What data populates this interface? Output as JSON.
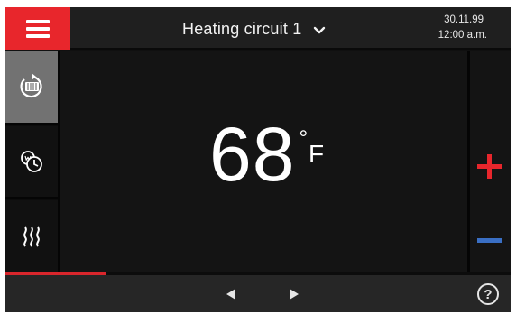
{
  "header": {
    "menu_icon": "hamburger-menu-icon",
    "title": "Heating circuit 1",
    "dropdown_icon": "chevron-down-icon",
    "date": "30.11.99",
    "time": "12:00 a.m."
  },
  "sidebar": {
    "items": [
      {
        "name": "manual-mode",
        "icon": "radiator-cycle-icon",
        "active": true
      },
      {
        "name": "timer-program",
        "icon": "clock-program-icon",
        "active": false
      },
      {
        "name": "heating",
        "icon": "heat-waves-icon",
        "active": false
      }
    ]
  },
  "main": {
    "temperature": "68",
    "degree_symbol": "°",
    "unit": "F"
  },
  "controls": {
    "increase_icon": "plus-icon",
    "decrease_icon": "minus-icon"
  },
  "progress": {
    "fraction": 0.2
  },
  "footer": {
    "prev_icon": "arrow-left-icon",
    "next_icon": "arrow-right-icon",
    "help_label": "?"
  },
  "colors": {
    "accent_red": "#e8262c",
    "accent_blue": "#3a6fc4",
    "background": "#141414"
  }
}
